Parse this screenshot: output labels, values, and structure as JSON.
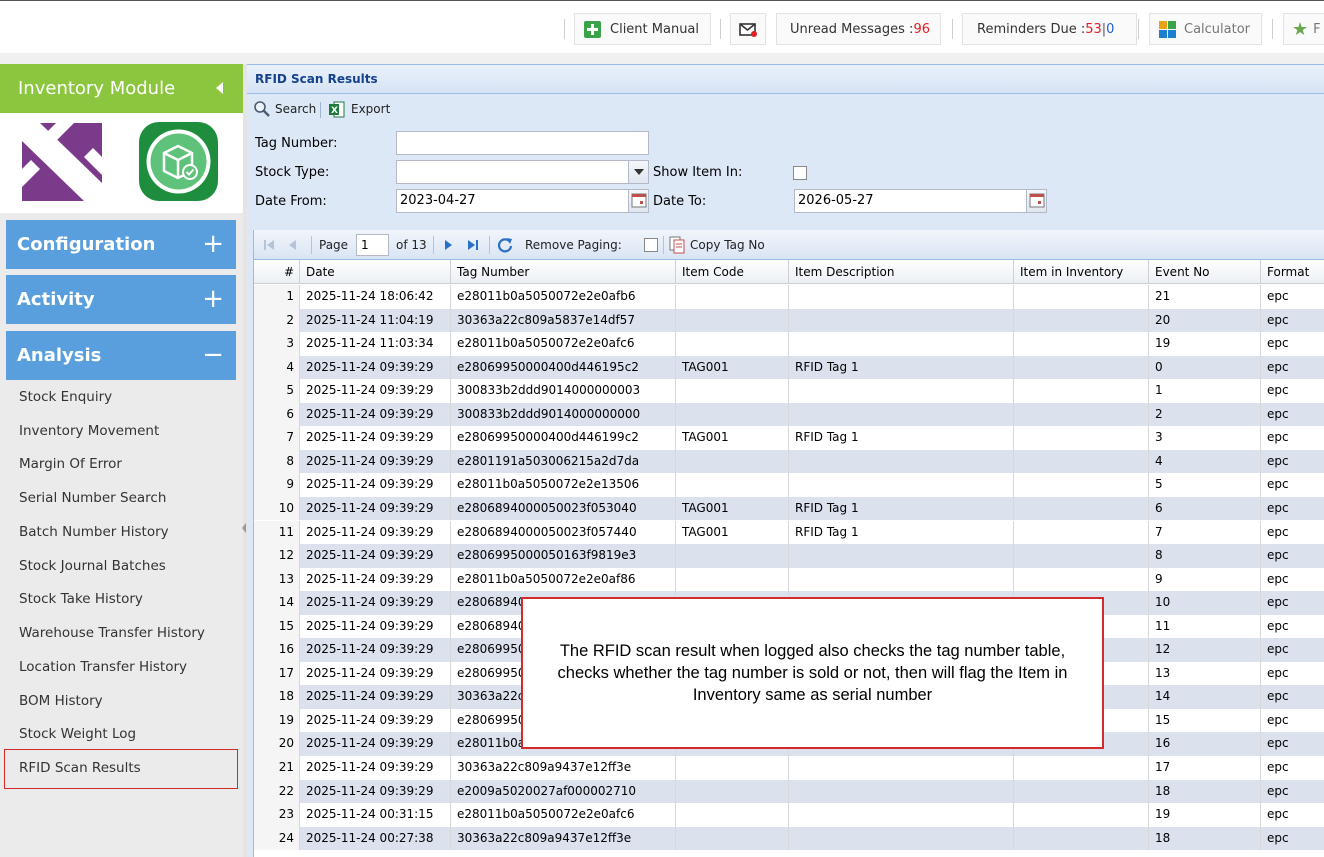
{
  "topbar": {
    "client_manual": "Client Manual",
    "unread_label": "Unread Messages : ",
    "unread_count": "96",
    "reminders_label": "Reminders Due : ",
    "reminders_count": "53",
    "reminders_sep": "|",
    "reminders_other": "0",
    "calculator": "Calculator",
    "favourites_initial": "F"
  },
  "sidebar": {
    "module_title": "Inventory Module",
    "sections": {
      "configuration": "Configuration",
      "activity": "Activity",
      "analysis": "Analysis"
    },
    "plus": "+",
    "minus": "−",
    "items": [
      "Stock Enquiry",
      "Inventory Movement",
      "Margin Of Error",
      "Serial Number Search",
      "Batch Number History",
      "Stock Journal Batches",
      "Stock Take History",
      "Warehouse Transfer History",
      "Location Transfer History",
      "BOM History",
      "Stock Weight Log",
      "RFID Scan Results"
    ]
  },
  "panel": {
    "title": "RFID Scan Results",
    "toolbar": {
      "search": "Search",
      "export": "Export"
    },
    "form": {
      "tag_number_label": "Tag Number:",
      "tag_number_value": "",
      "stock_type_label": "Stock Type:",
      "stock_type_value": "",
      "show_item_in_label": "Show Item In:",
      "date_from_label": "Date From:",
      "date_from_value": "2023-04-27",
      "date_to_label": "Date To:",
      "date_to_value": "2026-05-27"
    },
    "pager": {
      "page_label": "Page",
      "page_value": "1",
      "of_label": "of 13",
      "remove_paging": "Remove Paging:",
      "copy_tag_no": "Copy Tag No"
    }
  },
  "grid": {
    "columns": [
      "#",
      "Date",
      "Tag Number",
      "Item Code",
      "Item Description",
      "Item in Inventory",
      "Event No",
      "Format"
    ],
    "rows": [
      [
        "1",
        "2025-11-24 18:06:42",
        "e28011b0a5050072e2e0afb6",
        "",
        "",
        "",
        "21",
        "epc"
      ],
      [
        "2",
        "2025-11-24 11:04:19",
        "30363a22c809a5837e14df57",
        "",
        "",
        "",
        "20",
        "epc"
      ],
      [
        "3",
        "2025-11-24 11:03:34",
        "e28011b0a5050072e2e0afc6",
        "",
        "",
        "",
        "19",
        "epc"
      ],
      [
        "4",
        "2025-11-24 09:39:29",
        "e28069950000400d446195c2",
        "TAG001",
        "RFID Tag 1",
        "",
        "0",
        "epc"
      ],
      [
        "5",
        "2025-11-24 09:39:29",
        "300833b2ddd9014000000003",
        "",
        "",
        "",
        "1",
        "epc"
      ],
      [
        "6",
        "2025-11-24 09:39:29",
        "300833b2ddd9014000000000",
        "",
        "",
        "",
        "2",
        "epc"
      ],
      [
        "7",
        "2025-11-24 09:39:29",
        "e28069950000400d446199c2",
        "TAG001",
        "RFID Tag 1",
        "",
        "3",
        "epc"
      ],
      [
        "8",
        "2025-11-24 09:39:29",
        "e2801191a503006215a2d7da",
        "",
        "",
        "",
        "4",
        "epc"
      ],
      [
        "9",
        "2025-11-24 09:39:29",
        "e28011b0a5050072e2e13506",
        "",
        "",
        "",
        "5",
        "epc"
      ],
      [
        "10",
        "2025-11-24 09:39:29",
        "e2806894000050023f053040",
        "TAG001",
        "RFID Tag 1",
        "",
        "6",
        "epc"
      ],
      [
        "11",
        "2025-11-24 09:39:29",
        "e2806894000050023f057440",
        "TAG001",
        "RFID Tag 1",
        "",
        "7",
        "epc"
      ],
      [
        "12",
        "2025-11-24 09:39:29",
        "e2806995000050163f9819e3",
        "",
        "",
        "",
        "8",
        "epc"
      ],
      [
        "13",
        "2025-11-24 09:39:29",
        "e28011b0a5050072e2e0af86",
        "",
        "",
        "",
        "9",
        "epc"
      ],
      [
        "14",
        "2025-11-24 09:39:29",
        "e280689400",
        "",
        "",
        "",
        "10",
        "epc"
      ],
      [
        "15",
        "2025-11-24 09:39:29",
        "e280689400",
        "",
        "",
        "",
        "11",
        "epc"
      ],
      [
        "16",
        "2025-11-24 09:39:29",
        "e280699500",
        "",
        "",
        "",
        "12",
        "epc"
      ],
      [
        "17",
        "2025-11-24 09:39:29",
        "e280699500",
        "",
        "",
        "",
        "13",
        "epc"
      ],
      [
        "18",
        "2025-11-24 09:39:29",
        "30363a22c8",
        "",
        "",
        "",
        "14",
        "epc"
      ],
      [
        "19",
        "2025-11-24 09:39:29",
        "e280699500",
        "",
        "",
        "",
        "15",
        "epc"
      ],
      [
        "20",
        "2025-11-24 09:39:29",
        "e28011b0a5",
        "",
        "",
        "",
        "16",
        "epc"
      ],
      [
        "21",
        "2025-11-24 09:39:29",
        "30363a22c809a9437e12ff3e",
        "",
        "",
        "",
        "17",
        "epc"
      ],
      [
        "22",
        "2025-11-24 09:39:29",
        "e2009a5020027af000002710",
        "",
        "",
        "",
        "18",
        "epc"
      ],
      [
        "23",
        "2025-11-24 00:31:15",
        "e28011b0a5050072e2e0afc6",
        "",
        "",
        "",
        "19",
        "epc"
      ],
      [
        "24",
        "2025-11-24 00:27:38",
        "30363a22c809a9437e12ff3e",
        "",
        "",
        "",
        "18",
        "epc"
      ]
    ]
  },
  "callout": {
    "text": "The RFID scan result when logged also checks the tag number table, checks whether the tag number is sold or not, then will flag the Item in Inventory same as serial number"
  },
  "colors": {
    "module_green": "#8cc63f",
    "accordion_blue": "#5a9fdd",
    "panel_blue": "#dde8f7",
    "highlight_red": "#d42a2a",
    "alt_row": "#dbe2ee"
  }
}
